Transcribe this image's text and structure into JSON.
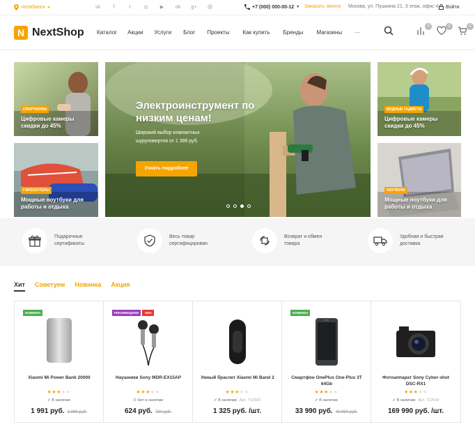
{
  "topbar": {
    "city": "Челябинск",
    "phone": "+7 (000) 000-00-12",
    "callback": "Заказать звонок",
    "address": "Москва, ул. Пушкина 21, 3 этаж, офис 4",
    "login": "Войти",
    "social": [
      "vk-icon",
      "facebook-icon",
      "twitter-icon",
      "instagram-icon",
      "youtube-icon",
      "odnoklassniki-icon",
      "google-plus-icon",
      "mail-ru-icon"
    ]
  },
  "header": {
    "logo_mark": "N",
    "logo_text": "NextShop",
    "nav": [
      "Каталог",
      "Акции",
      "Услуги",
      "Блог",
      "Проекты",
      "Как купить",
      "Бренды",
      "Магазины",
      "···"
    ],
    "compare_count": "0",
    "favorites_count": "0",
    "cart_count": "0"
  },
  "banners": {
    "left_top": {
      "tag": "СМАРТФОНЫ",
      "title": "Цифровые камеры скидки до 45%"
    },
    "left_bottom": {
      "tag": "ГИРОСКУТЕРЫ",
      "title": "Мощные ноутбуки для работы и отдыха"
    },
    "hero": {
      "title": "Электроинструмент по низким ценам!",
      "subtitle": "Широкий выбор компактных шуруповертов от 1 399 руб.",
      "button": "Узнать подробнее",
      "slides": 4,
      "active_slide": 3
    },
    "right_top": {
      "tag": "МОДНЫЕ ГАДЖЕТЫ",
      "title": "Цифровые камеры скидки до 45%"
    },
    "right_bottom": {
      "tag": "НОУТБУКИ",
      "title": "Мощные ноутбуки для работы и отдыха"
    }
  },
  "features": [
    {
      "icon": "gift-icon",
      "text": "Подарочные сертификаты"
    },
    {
      "icon": "shield-check-icon",
      "text": "Весь товар сертифицирован"
    },
    {
      "icon": "return-box-icon",
      "text": "Возврат и обмен товара"
    },
    {
      "icon": "delivery-truck-icon",
      "text": "Удобная и быстрая доставка"
    }
  ],
  "tabs": [
    "Хит",
    "Советуем",
    "Новинка",
    "Акция"
  ],
  "products": [
    {
      "badges": [
        {
          "text": "НОВИНКА",
          "color": "#4caf50"
        }
      ],
      "name": "Xiaomi Mi Power Bank 20000",
      "rating": 3,
      "stock": "В наличии",
      "in_stock": true,
      "article": "",
      "price": "1 991 руб.",
      "old_price": "2 999 руб."
    },
    {
      "badges": [
        {
          "text": "РЕКОМЕНДУЕМ",
          "color": "#9b3fb8"
        },
        {
          "text": "-25%",
          "color": "#e53935"
        }
      ],
      "name": "Наушники Sony MDR-EX15AP",
      "rating": 3,
      "stock": "Нет в наличии",
      "in_stock": false,
      "article": "",
      "price": "624 руб.",
      "old_price": "780 руб."
    },
    {
      "badges": [],
      "name": "Умный браслет Xiaomi Mi Band 2",
      "rating": 3,
      "stock": "В наличии",
      "in_stock": true,
      "article": "Арт. 712543",
      "price": "1 325 руб. /шт.",
      "old_price": ""
    },
    {
      "badges": [
        {
          "text": "НОВИНКА",
          "color": "#4caf50"
        }
      ],
      "name": "Смартфон OnePlus One-Plus 3T 64Gb",
      "rating": 3,
      "stock": "В наличии",
      "in_stock": true,
      "article": "",
      "price": "33 990 руб.",
      "old_price": "40 990 руб."
    },
    {
      "badges": [],
      "name": "Фотоаппарат Sony Cyber-shot DSC-RX1",
      "rating": 3,
      "stock": "В наличии",
      "in_stock": true,
      "article": "Арт. 712543",
      "price": "169 990 руб. /шт.",
      "old_price": ""
    }
  ],
  "colors": {
    "accent": "#f6a400",
    "new_badge": "#4caf50",
    "recommend_badge": "#9b3fb8",
    "sale_badge": "#e53935"
  }
}
